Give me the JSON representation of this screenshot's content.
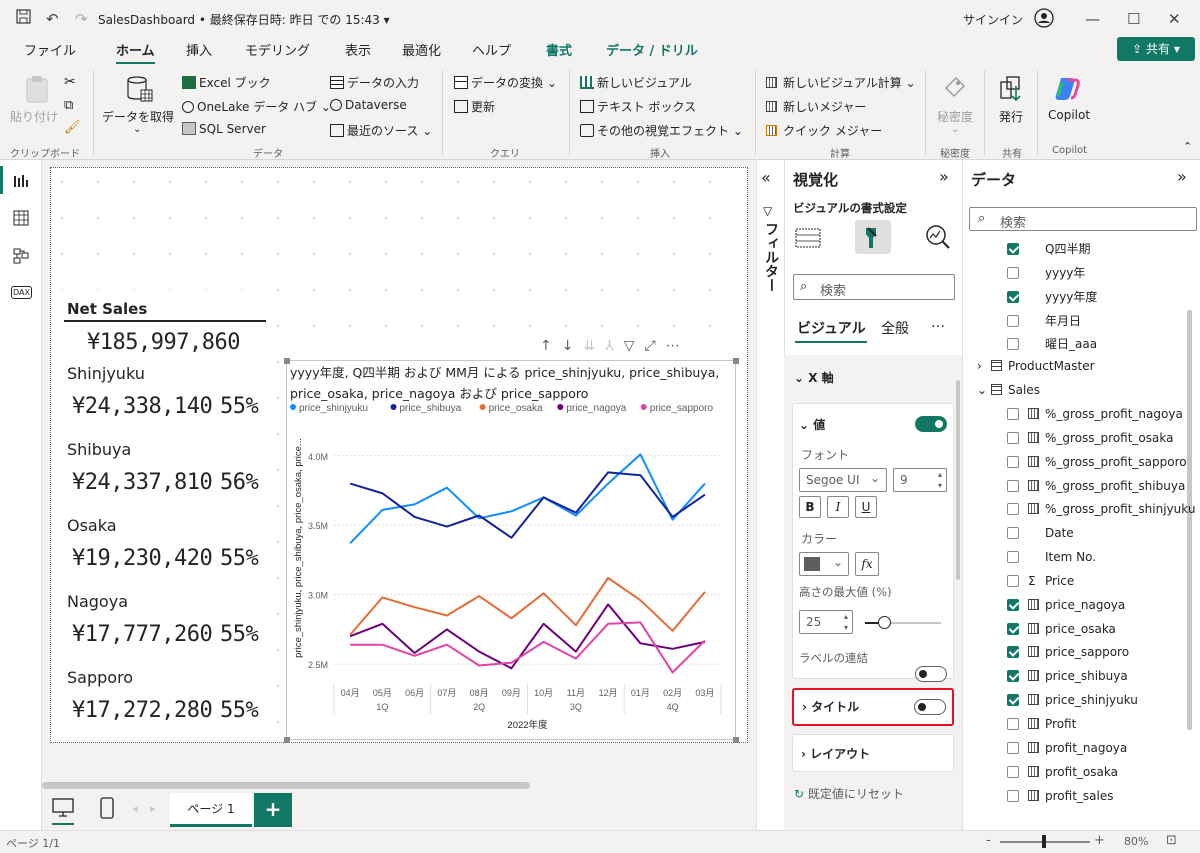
{
  "titlebar": {
    "title": "SalesDashboard • 最終保存日時: 昨日 での 15:43 ▾",
    "signin": "サインイン"
  },
  "menu": {
    "items": [
      "ファイル",
      "ホーム",
      "挿入",
      "モデリング",
      "表示",
      "最適化",
      "ヘルプ"
    ],
    "contextual": [
      "書式",
      "データ / ドリル"
    ],
    "share": "共有"
  },
  "ribbon": {
    "paste": "貼り付け",
    "get_data": "データを取得",
    "excel": "Excel ブック",
    "onelake": "OneLake データ ハブ",
    "sql": "SQL Server",
    "enter_data": "データの入力",
    "dataverse": "Dataverse",
    "recent": "最近のソース",
    "transform": "データの変換",
    "refresh": "更新",
    "new_visual": "新しいビジュアル",
    "textbox": "テキスト ボックス",
    "more_visuals": "その他の視覚エフェクト",
    "new_calc": "新しいビジュアル計算",
    "new_measure": "新しいメジャー",
    "quick_measure": "クイック メジャー",
    "sensitivity": "秘密度",
    "publish": "発行",
    "copilot": "Copilot",
    "groups": [
      "クリップボード",
      "データ",
      "クエリ",
      "挿入",
      "計算",
      "秘密度",
      "共有",
      "Copilot"
    ]
  },
  "sales": {
    "title": "Net Sales",
    "total": "¥185,997,860",
    "rows": [
      {
        "label": "Shinjyuku",
        "value": "¥24,338,140",
        "pct": "55%"
      },
      {
        "label": "Shibuya",
        "value": "¥24,337,810",
        "pct": "56%"
      },
      {
        "label": "Osaka",
        "value": "¥19,230,420",
        "pct": "55%"
      },
      {
        "label": "Nagoya",
        "value": "¥17,777,260",
        "pct": "55%"
      },
      {
        "label": "Sapporo",
        "value": "¥17,272,280",
        "pct": "55%"
      }
    ]
  },
  "chart_data": {
    "type": "line",
    "title": "yyyy年度, Q四半期 および MM月 による price_shinjyuku, price_shibuya, price_osaka, price_nagoya および price_sapporo",
    "ylabel": "price_shinjyuku, price_shibuya, price_osaka, price...",
    "xlabel": "2022年度",
    "categories": [
      "04月",
      "05月",
      "06月",
      "07月",
      "08月",
      "09月",
      "10月",
      "11月",
      "12月",
      "01月",
      "02月",
      "03月"
    ],
    "quarters": [
      "1Q",
      "2Q",
      "3Q",
      "4Q"
    ],
    "yticks": [
      "4.0M",
      "3.5M",
      "3.0M",
      "2.5M"
    ],
    "ylim": [
      2.4,
      4.2
    ],
    "series": [
      {
        "name": "price_shinjyuku",
        "color": "#118DFF",
        "values": [
          3.37,
          3.61,
          3.65,
          3.77,
          3.55,
          3.6,
          3.7,
          3.57,
          3.8,
          4.01,
          3.54,
          3.8
        ]
      },
      {
        "name": "price_shibuya",
        "color": "#12239E",
        "values": [
          3.8,
          3.73,
          3.56,
          3.49,
          3.57,
          3.41,
          3.7,
          3.59,
          3.88,
          3.86,
          3.56,
          3.72
        ]
      },
      {
        "name": "price_osaka",
        "color": "#E66C37",
        "values": [
          2.71,
          2.98,
          2.91,
          2.85,
          2.99,
          2.83,
          3.01,
          2.78,
          3.12,
          2.96,
          2.74,
          3.02
        ]
      },
      {
        "name": "price_nagoya",
        "color": "#6B007B",
        "values": [
          2.7,
          2.79,
          2.58,
          2.75,
          2.59,
          2.47,
          2.79,
          2.59,
          2.93,
          2.65,
          2.61,
          2.66
        ]
      },
      {
        "name": "price_sapporo",
        "color": "#E044A7",
        "values": [
          2.64,
          2.64,
          2.56,
          2.64,
          2.49,
          2.51,
          2.66,
          2.54,
          2.79,
          2.8,
          2.44,
          2.67
        ]
      }
    ]
  },
  "filters": {
    "label": "フィルター"
  },
  "viz": {
    "title": "視覚化",
    "subtitle": "ビジュアルの書式設定",
    "search": "検索",
    "tabs": [
      "ビジュアル",
      "全般"
    ],
    "more": "…",
    "xaxis": "X 軸",
    "values": "値",
    "font_label": "フォント",
    "font_name": "Segoe UI",
    "font_size": "9",
    "color_label": "カラー",
    "fx": "fx",
    "maxheight_label": "高さの最大値 (%)",
    "maxheight": "25",
    "concat_label": "ラベルの連結",
    "title_section": "タイトル",
    "layout_section": "レイアウト",
    "reset": "既定値にリセット"
  },
  "data_pane": {
    "title": "データ",
    "search": "検索",
    "fields": [
      {
        "name": "Q四半期",
        "checked": true,
        "indent": 1,
        "kind": "none"
      },
      {
        "name": "yyyy年",
        "checked": false,
        "indent": 1,
        "kind": "none"
      },
      {
        "name": "yyyy年度",
        "checked": true,
        "indent": 1,
        "kind": "none"
      },
      {
        "name": "年月日",
        "checked": false,
        "indent": 1,
        "kind": "none"
      },
      {
        "name": "曜日_aaa",
        "checked": false,
        "indent": 1,
        "kind": "none"
      },
      {
        "name": "ProductMaster",
        "checked": null,
        "indent": 0,
        "kind": "table"
      },
      {
        "name": "Sales",
        "checked": null,
        "indent": 0,
        "kind": "table-open"
      },
      {
        "name": "%_gross_profit_nagoya",
        "checked": false,
        "indent": 1,
        "kind": "calc"
      },
      {
        "name": "%_gross_profit_osaka",
        "checked": false,
        "indent": 1,
        "kind": "calc"
      },
      {
        "name": "%_gross_profit_sapporo",
        "checked": false,
        "indent": 1,
        "kind": "calc"
      },
      {
        "name": "%_gross_profit_shibuya",
        "checked": false,
        "indent": 1,
        "kind": "calc"
      },
      {
        "name": "%_gross_profit_shinjyuku",
        "checked": false,
        "indent": 1,
        "kind": "calc"
      },
      {
        "name": "Date",
        "checked": false,
        "indent": 1,
        "kind": "none"
      },
      {
        "name": "Item No.",
        "checked": false,
        "indent": 1,
        "kind": "none"
      },
      {
        "name": "Price",
        "checked": false,
        "indent": 1,
        "kind": "sigma"
      },
      {
        "name": "price_nagoya",
        "checked": true,
        "indent": 1,
        "kind": "calc"
      },
      {
        "name": "price_osaka",
        "checked": true,
        "indent": 1,
        "kind": "calc"
      },
      {
        "name": "price_sapporo",
        "checked": true,
        "indent": 1,
        "kind": "calc"
      },
      {
        "name": "price_shibuya",
        "checked": true,
        "indent": 1,
        "kind": "calc"
      },
      {
        "name": "price_shinjyuku",
        "checked": true,
        "indent": 1,
        "kind": "calc"
      },
      {
        "name": "Profit",
        "checked": false,
        "indent": 1,
        "kind": "calc"
      },
      {
        "name": "profit_nagoya",
        "checked": false,
        "indent": 1,
        "kind": "calc"
      },
      {
        "name": "profit_osaka",
        "checked": false,
        "indent": 1,
        "kind": "calc"
      },
      {
        "name": "profit_sales",
        "checked": false,
        "indent": 1,
        "kind": "calc"
      }
    ]
  },
  "bottom": {
    "page_tab": "ページ 1",
    "add": "+"
  },
  "status": {
    "page": "ページ 1/1",
    "zoom": "80%"
  },
  "colors": {
    "accent": "#117865",
    "highlight": "#E81123"
  }
}
